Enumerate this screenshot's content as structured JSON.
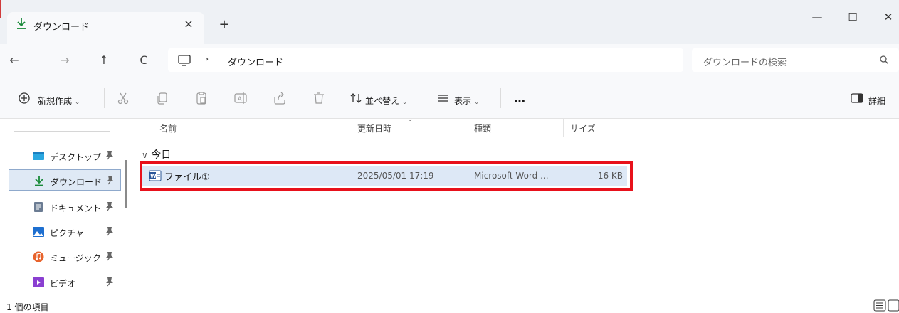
{
  "window": {
    "tab_title": "ダウンロード",
    "tab_close": "×",
    "new_tab": "+",
    "minimize": "—",
    "maximize": "☐",
    "close": "✕"
  },
  "navigation": {
    "back": "←",
    "forward": "→",
    "up": "↑",
    "refresh": "C",
    "breadcrumb_separator": "›",
    "breadcrumb": "ダウンロード",
    "search_placeholder": "ダウンロードの検索"
  },
  "toolbar": {
    "new_label": "新規作成",
    "sort_label": "並べ替え",
    "view_label": "表示",
    "more_label": "…",
    "details_label": "詳細"
  },
  "sidebar": {
    "items": [
      {
        "label": "デスクトップ",
        "icon": "desktop-folder-icon"
      },
      {
        "label": "ダウンロード",
        "icon": "download-arrow-icon",
        "selected": true
      },
      {
        "label": "ドキュメント",
        "icon": "document-folder-icon"
      },
      {
        "label": "ピクチャ",
        "icon": "pictures-folder-icon"
      },
      {
        "label": "ミュージック",
        "icon": "music-folder-icon"
      },
      {
        "label": "ビデオ",
        "icon": "video-folder-icon"
      }
    ]
  },
  "columns": {
    "name": "名前",
    "date": "更新日時",
    "type": "種類",
    "size": "サイズ"
  },
  "group_label": "今日",
  "files": [
    {
      "name": "ファイル①",
      "date": "2025/05/01 17:19",
      "type": "Microsoft Word ...",
      "size": "16 KB"
    }
  ],
  "status": {
    "item_count": "1 個の項目"
  },
  "colors": {
    "highlight_border": "#e8111b",
    "selected_row": "#dde8f6",
    "titlebar_bg": "#eef1f5",
    "accent_download": "#1a8a3a"
  }
}
